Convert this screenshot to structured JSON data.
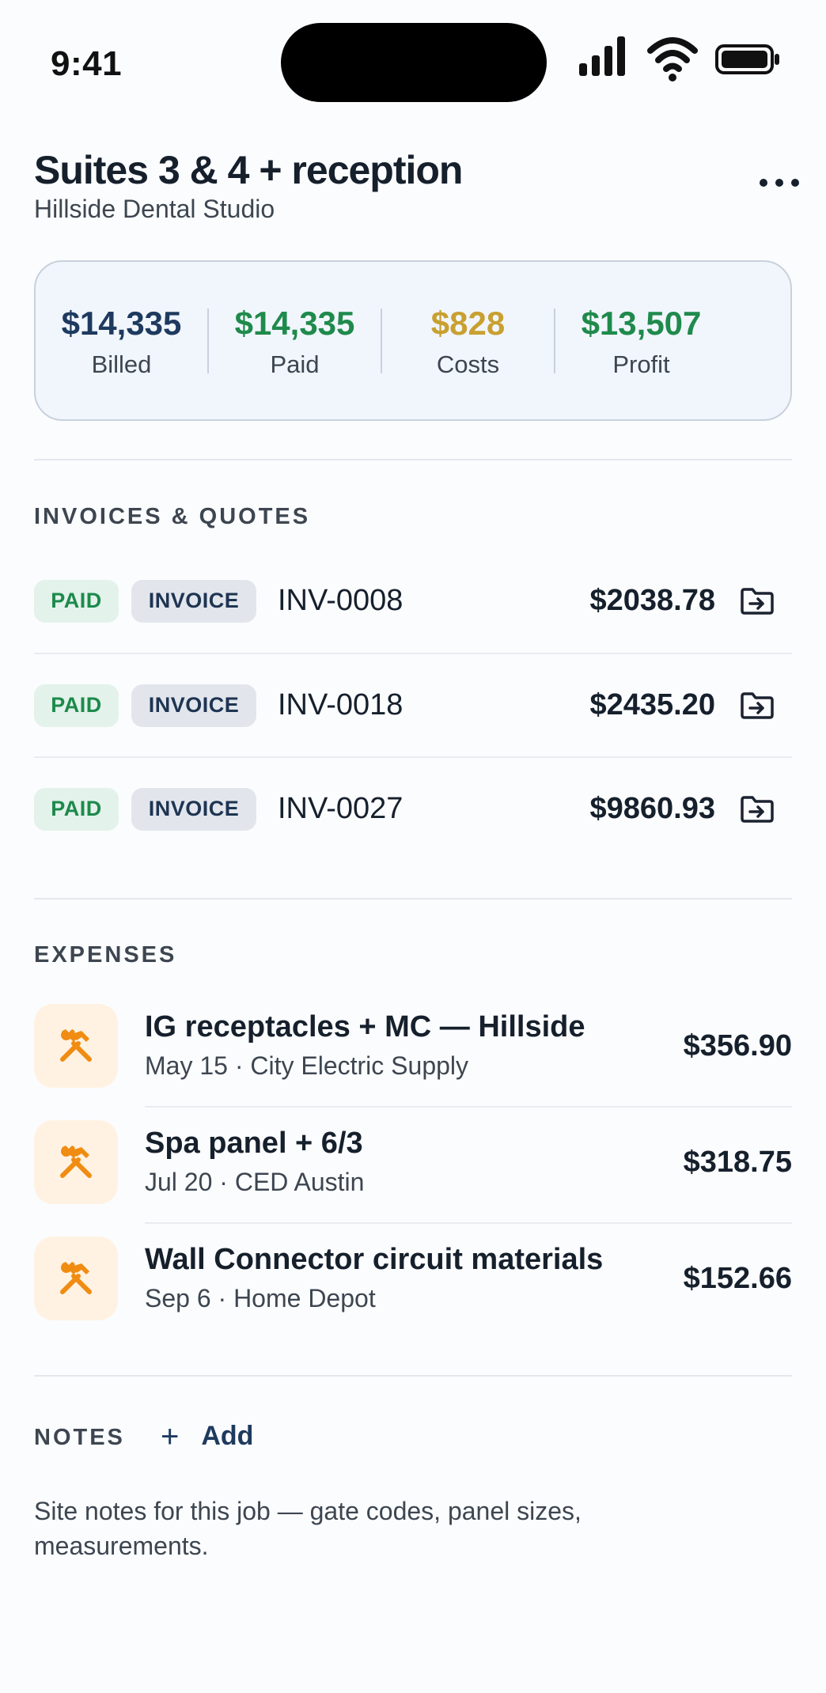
{
  "status_bar": {
    "time": "9:41"
  },
  "header": {
    "title": "Suites 3 & 4 + reception",
    "client": "Hillside Dental Studio"
  },
  "summary": [
    {
      "value": "$14,335",
      "label": "Billed",
      "color": "#1e3a5f"
    },
    {
      "value": "$14,335",
      "label": "Paid",
      "color": "#1f8a4c"
    },
    {
      "value": "$828",
      "label": "Costs",
      "color": "#c9a030"
    },
    {
      "value": "$13,507",
      "label": "Profit",
      "color": "#1f8a4c"
    }
  ],
  "invoices": {
    "section_label": "INVOICES & QUOTES",
    "items": [
      {
        "status": "PAID",
        "type": "INVOICE",
        "number": "INV-0008",
        "amount": "$2038.78"
      },
      {
        "status": "PAID",
        "type": "INVOICE",
        "number": "INV-0018",
        "amount": "$2435.20"
      },
      {
        "status": "PAID",
        "type": "INVOICE",
        "number": "INV-0027",
        "amount": "$9860.93"
      }
    ]
  },
  "expenses": {
    "section_label": "EXPENSES",
    "items": [
      {
        "title": "IG receptacles + MC — Hillside",
        "meta": "May 15 · City Electric Supply",
        "amount": "$356.90",
        "icon": "tools-icon"
      },
      {
        "title": "Spa panel + 6/3",
        "meta": "Jul 20 · CED Austin",
        "amount": "$318.75",
        "icon": "tools-icon"
      },
      {
        "title": "Wall Connector circuit materials",
        "meta": "Sep 6 · Home Depot",
        "amount": "$152.66",
        "icon": "tools-icon"
      }
    ]
  },
  "notes": {
    "section_label": "NOTES",
    "add_symbol": "+",
    "add_label": "Add",
    "placeholder": "Site notes for this job — gate codes, panel sizes, measurements."
  },
  "colors": {
    "accent": "#1e3a5f",
    "success": "#1f8a4c",
    "warning": "#c9a030",
    "expense_icon": "#f08c12"
  }
}
